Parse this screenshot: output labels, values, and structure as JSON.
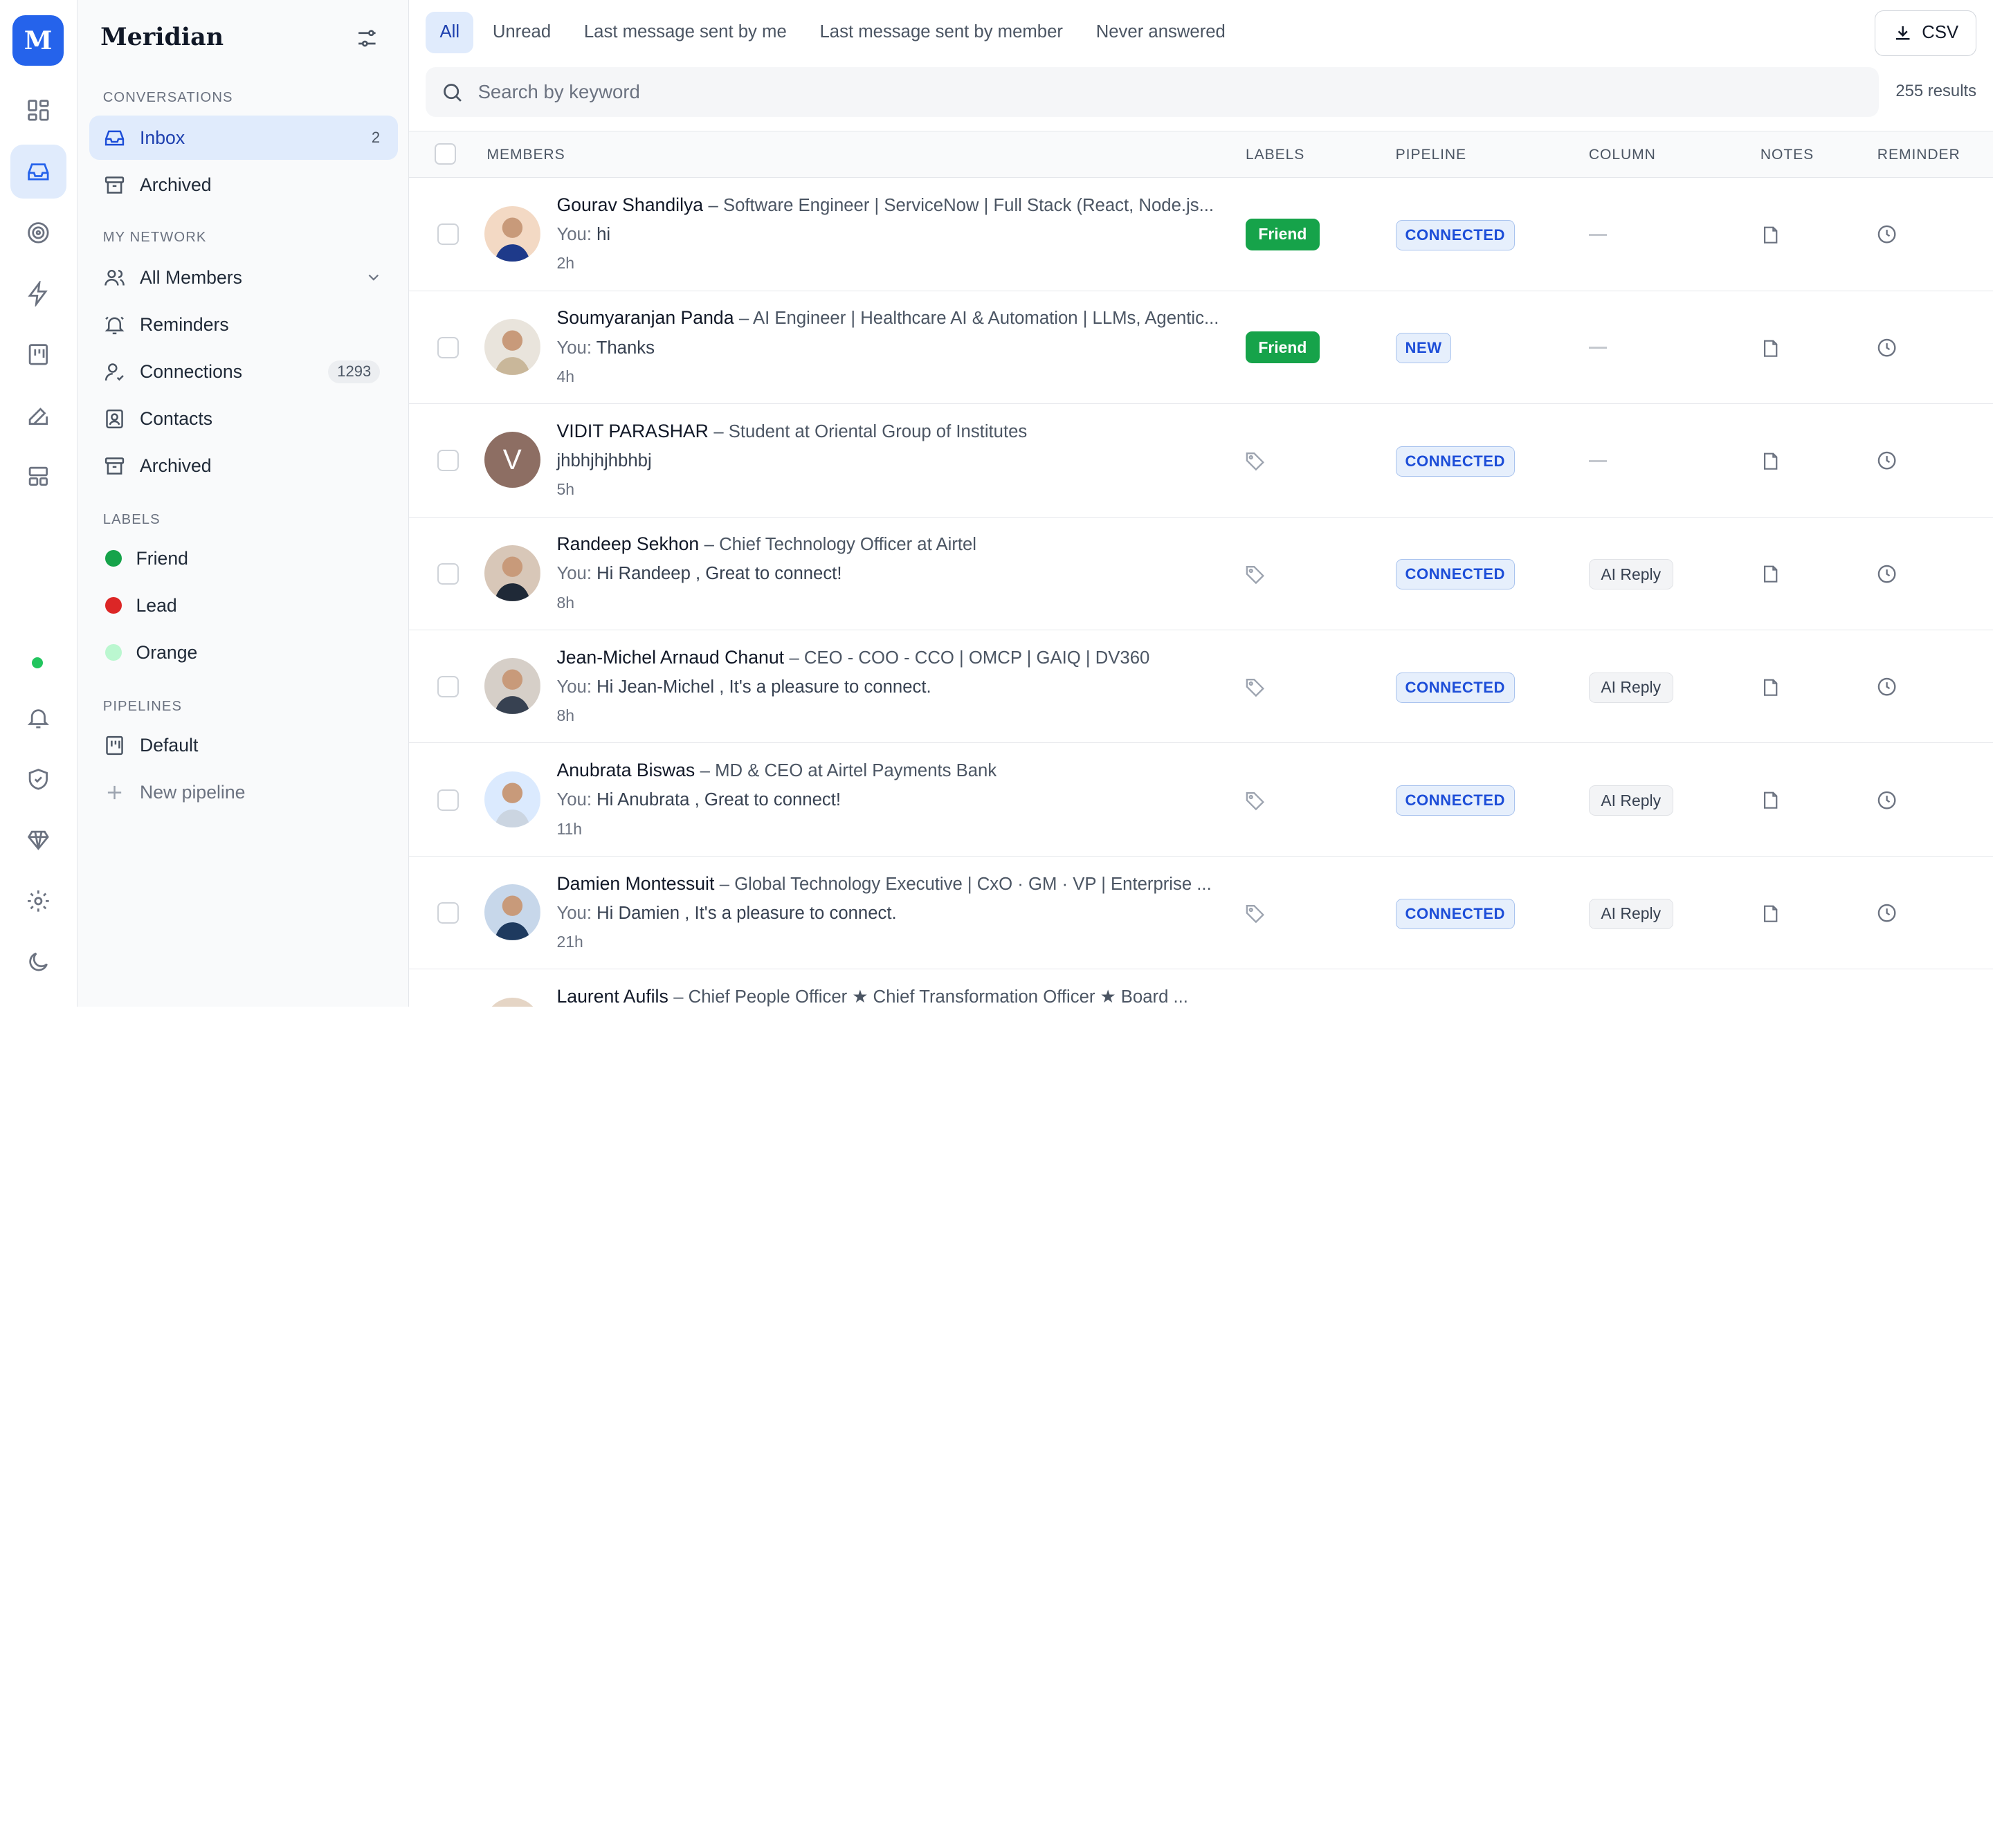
{
  "brand": {
    "logo_letter": "M",
    "name": "Meridian",
    "accent": "#2563eb"
  },
  "rail": {
    "icons": [
      "dashboard-icon",
      "inbox-icon",
      "target-icon",
      "bolt-icon",
      "kanban-icon",
      "edit-icon",
      "layout-icon",
      "bell-icon",
      "shield-icon",
      "diamond-icon",
      "gear-icon",
      "moon-icon"
    ]
  },
  "sidebar": {
    "conversations_heading": "CONVERSATIONS",
    "inbox": {
      "label": "Inbox",
      "count": "2"
    },
    "archived_conv": {
      "label": "Archived"
    },
    "network_heading": "MY NETWORK",
    "all_members": {
      "label": "All Members"
    },
    "reminders": {
      "label": "Reminders"
    },
    "connections": {
      "label": "Connections",
      "count": "1293"
    },
    "contacts": {
      "label": "Contacts"
    },
    "archived_net": {
      "label": "Archived"
    },
    "labels_heading": "LABELS",
    "labels": [
      {
        "label": "Friend",
        "color": "#16a34a"
      },
      {
        "label": "Lead",
        "color": "#dc2626"
      },
      {
        "label": "Orange",
        "color": "#bbf7d0"
      }
    ],
    "pipelines_heading": "PIPELINES",
    "default_pipeline": {
      "label": "Default"
    },
    "new_pipeline": {
      "label": "New pipeline"
    }
  },
  "tabs": [
    "All",
    "Unread",
    "Last message sent by me",
    "Last message sent by member",
    "Never answered"
  ],
  "csv_label": "CSV",
  "search": {
    "placeholder": "Search by keyword",
    "value": ""
  },
  "results": "255 results",
  "columns": {
    "members": "MEMBERS",
    "labels": "LABELS",
    "pipeline": "PIPELINE",
    "column": "COLUMN",
    "notes": "NOTES",
    "reminder": "REMINDER"
  },
  "rows": [
    {
      "name": "Gourav Shandilya",
      "title": "Software Engineer | ServiceNow | Full Stack (React, Node.js...",
      "you": "You:",
      "message": "hi",
      "time": "2h",
      "label": "Friend",
      "pipeline": "CONNECTED",
      "column": "",
      "avatar": "photo"
    },
    {
      "name": "Soumyaranjan Panda",
      "title": "AI Engineer | Healthcare AI & Automation | LLMs, Agentic...",
      "you": "You:",
      "message": "Thanks",
      "time": "4h",
      "label": "Friend",
      "pipeline": "NEW",
      "column": "",
      "avatar": "photo"
    },
    {
      "name": "VIDIT PARASHAR",
      "title": "Student at Oriental Group of Institutes",
      "you": "",
      "message": "jhbhjhjhbhbj",
      "time": "5h",
      "label": "",
      "pipeline": "CONNECTED",
      "column": "",
      "avatar": "V"
    },
    {
      "name": "Randeep Sekhon",
      "title": "Chief Technology Officer at Airtel",
      "you": "You:",
      "message": "Hi Randeep , Great to connect!",
      "time": "8h",
      "label": "",
      "pipeline": "CONNECTED",
      "column": "AI Reply",
      "avatar": "photo"
    },
    {
      "name": "Jean-Michel Arnaud Chanut",
      "title": "CEO - COO - CCO | OMCP | GAIQ | DV360",
      "you": "You:",
      "message": "Hi Jean-Michel , It's a pleasure to connect.",
      "time": "8h",
      "label": "",
      "pipeline": "CONNECTED",
      "column": "AI Reply",
      "avatar": "photo"
    },
    {
      "name": "Anubrata Biswas",
      "title": "MD & CEO at Airtel Payments Bank",
      "you": "You:",
      "message": "Hi Anubrata , Great to connect!",
      "time": "11h",
      "label": "",
      "pipeline": "CONNECTED",
      "column": "AI Reply",
      "avatar": "photo"
    },
    {
      "name": "Damien Montessuit",
      "title": "Global Technology Executive | CxO · GM · VP | Enterprise ...",
      "you": "You:",
      "message": "Hi Damien , It's a pleasure to connect.",
      "time": "21h",
      "label": "",
      "pipeline": "CONNECTED",
      "column": "AI Reply",
      "avatar": "photo"
    },
    {
      "name": "Laurent Aufils",
      "title": "Chief People Officer ★ Chief Transformation Officer ★ Board ...",
      "you": "",
      "message": "",
      "time": "",
      "label": "",
      "pipeline": "",
      "column": "",
      "avatar": "photo"
    }
  ]
}
